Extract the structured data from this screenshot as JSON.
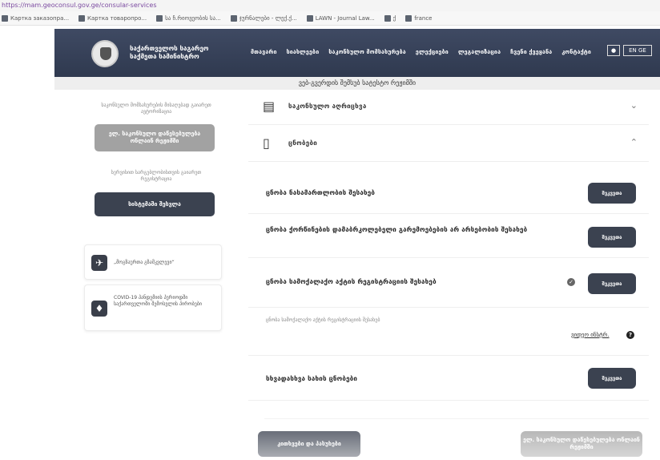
{
  "browser": {
    "url": "https://mam.geoconsul.gov.ge/consular-services",
    "bookmarks": [
      {
        "label": "Картка заказопра..."
      },
      {
        "label": "Картка товаропро..."
      },
      {
        "label": "სა ჩ.რიოვეობის სა..."
      },
      {
        "label": "ჯურნალები - ლექ.ქ..."
      },
      {
        "label": "LAWN - Journal Law..."
      },
      {
        "label": "ქ"
      },
      {
        "label": "france"
      }
    ]
  },
  "header": {
    "brand": "საქართველოს საგარეო საქმეთა სამინისტრო",
    "nav": [
      "მთავარი",
      "სიახლეები",
      "საკონსულო მომსახურება",
      "ელექციები",
      "ლეგალიზაცია",
      "ჩვენი ქვეყანა",
      "კონტაქტი"
    ],
    "user_icon": "user-icon",
    "lang": "EN GE"
  },
  "subheader": {
    "text": "ვებ-გვერდის შემსუბ სატესტო რეჟიმში"
  },
  "sidebar": {
    "text1": "საკონსულო მომსახურების მისაღებად გაიარეთ ავტორიზაცია",
    "btn1": "ელ. საკონსულო დაწესებულება ონლაინ რეჟიმში",
    "text2": "სერვისით სარგებლობისთვის გაიარეთ რეგისტრაცია",
    "btn2": "სისტემაში შესვლა",
    "cards": [
      {
        "icon": "airplane-icon",
        "text": "„მოგზაურთა გზამკვლევი“"
      },
      {
        "icon": "dog-icon",
        "text": "COVID-19 პანდემიის პერიოდში საქართველოში შემოსვლის პირობები"
      }
    ]
  },
  "accordion": [
    {
      "label": "საკონსულო აღრიცხვა",
      "icon": "document-icon",
      "expanded": false
    },
    {
      "label": "ცნობები",
      "icon": "phone-icon",
      "expanded": true
    }
  ],
  "items": [
    {
      "label": "ცნობა ნასამართლობის შესახებ",
      "button": "შეკვეთა"
    },
    {
      "label": "ცნობა ქორწინების დამაბრკოლებელი გარემოებების არ არსებობის შესახებ",
      "button": "შეკვეთა"
    },
    {
      "label": "ცნობა სამოქალაქო აქტის რეგისტრაციის შესახებ",
      "button": "შეკვეთა"
    },
    {
      "label": "სხვადასხვა სახის ცნობები",
      "button": "შეკვეთა"
    }
  ],
  "info_row": {
    "text": "ცნობა სამოქალაქო აქტის რეგისტრაციის შესახებ",
    "link": "ვიდეო ინსტრ.",
    "link_icon": "info-icon"
  },
  "bottom": {
    "left": "კითხვები და პასუხები",
    "right": "ელ. საკონსულო დაწესებულება ონლაინ რეჟიმში"
  },
  "colors": {
    "header": "#333d53",
    "dark_button": "#3b4250",
    "disabled_button": "#a2a2a2"
  }
}
